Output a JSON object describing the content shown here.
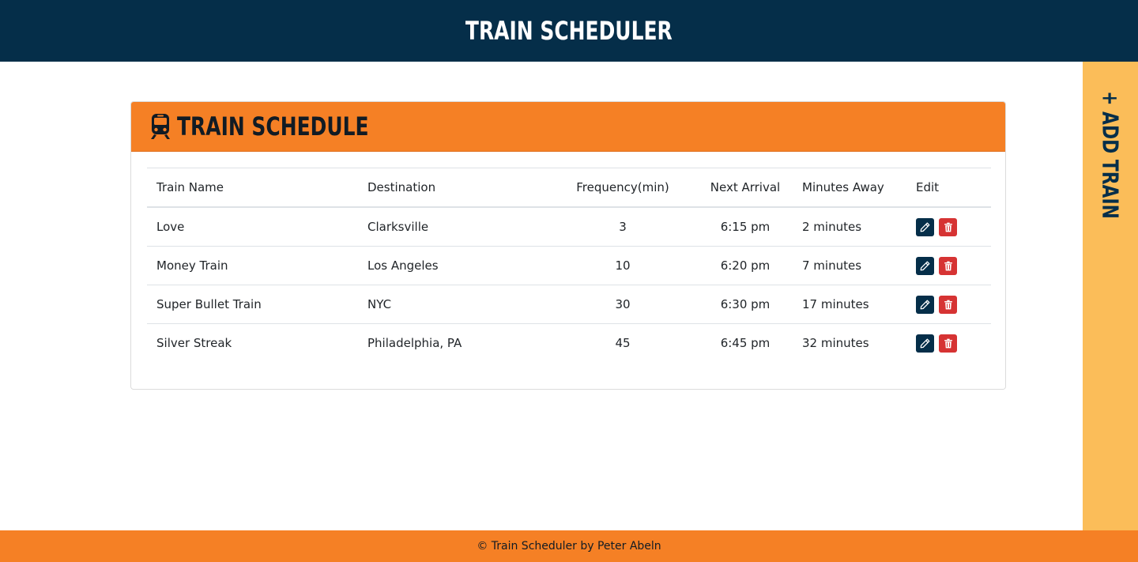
{
  "header": {
    "title": "TRAIN SCHEDULER"
  },
  "side_tab": {
    "label": "+ ADD TRAIN"
  },
  "schedule": {
    "title": "TRAIN SCHEDULE",
    "icon": "train-icon",
    "columns": [
      "Train Name",
      "Destination",
      "Frequency(min)",
      "Next Arrival",
      "Minutes Away",
      "Edit"
    ],
    "rows": [
      {
        "name": "Love",
        "destination": "Clarksville",
        "frequency": "3",
        "next_arrival": "6:15 pm",
        "minutes_away": "2 minutes"
      },
      {
        "name": "Money Train",
        "destination": "Los Angeles",
        "frequency": "10",
        "next_arrival": "6:20 pm",
        "minutes_away": "7 minutes"
      },
      {
        "name": "Super Bullet Train",
        "destination": "NYC",
        "frequency": "30",
        "next_arrival": "6:30 pm",
        "minutes_away": "17 minutes"
      },
      {
        "name": "Silver Streak",
        "destination": "Philadelphia, PA",
        "frequency": "45",
        "next_arrival": "6:45 pm",
        "minutes_away": "32 minutes"
      }
    ]
  },
  "footer": {
    "text": "© Train Scheduler by Peter Abeln"
  },
  "colors": {
    "header_bg": "#052e49",
    "accent_orange": "#f58025",
    "side_tab_bg": "#fbbd59",
    "edit_button": "#052e49",
    "delete_button": "#d63333"
  }
}
